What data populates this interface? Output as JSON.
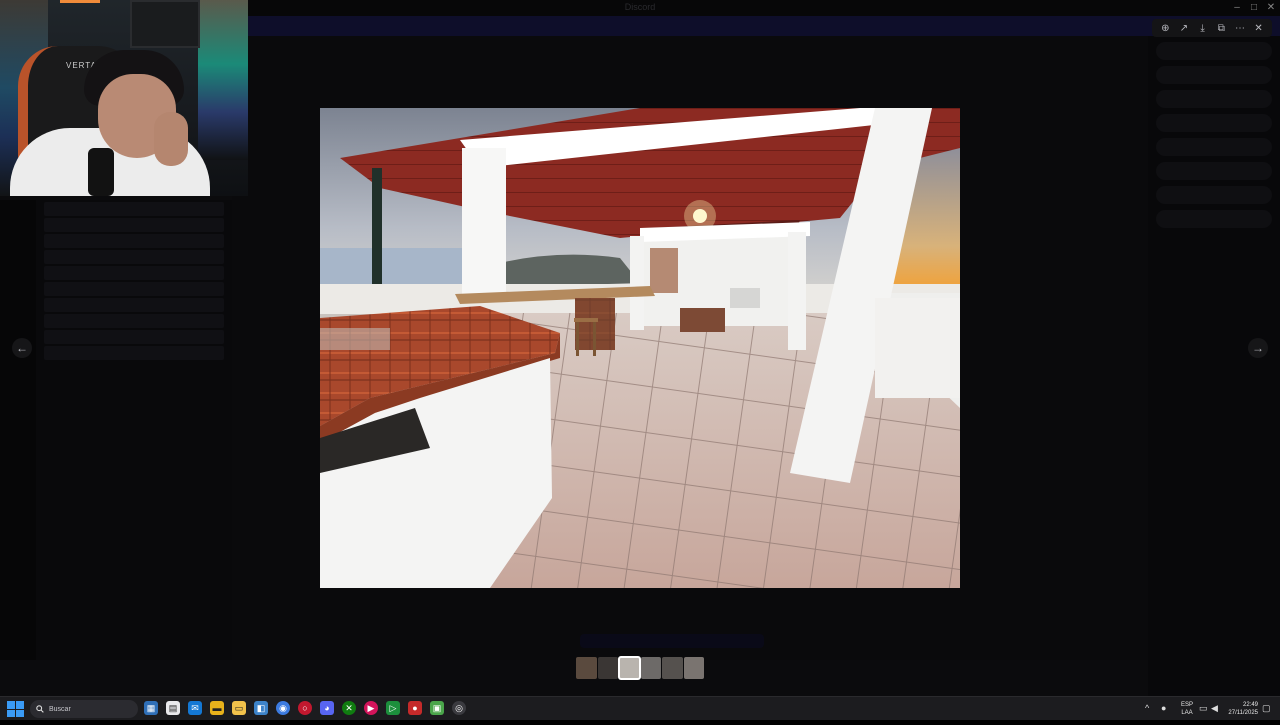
{
  "app": {
    "window_title": "Discord"
  },
  "webcam": {
    "chair_brand": "VERTAGE"
  },
  "viewer": {
    "toolbar": [
      {
        "icon": "zoom-in-icon",
        "glyph": "⊕"
      },
      {
        "icon": "share-icon",
        "glyph": "↗"
      },
      {
        "icon": "download-icon",
        "glyph": "⤓"
      },
      {
        "icon": "open-external-icon",
        "glyph": "⧉"
      },
      {
        "icon": "more-icon",
        "glyph": "⋯"
      },
      {
        "icon": "close-icon",
        "glyph": "✕"
      }
    ],
    "prev_glyph": "←",
    "next_glyph": "→",
    "thumbnail_count": 6,
    "selected_thumbnail": 3
  },
  "taskbar": {
    "search_placeholder": "Buscar",
    "language_line1": "ESP",
    "language_line2": "LAA",
    "time": "22:49",
    "date": "27/11/2025"
  },
  "colors": {
    "accent": "#3a9bf5",
    "roof_red": "#8c2a22",
    "tile_counter": "#a9482c"
  }
}
